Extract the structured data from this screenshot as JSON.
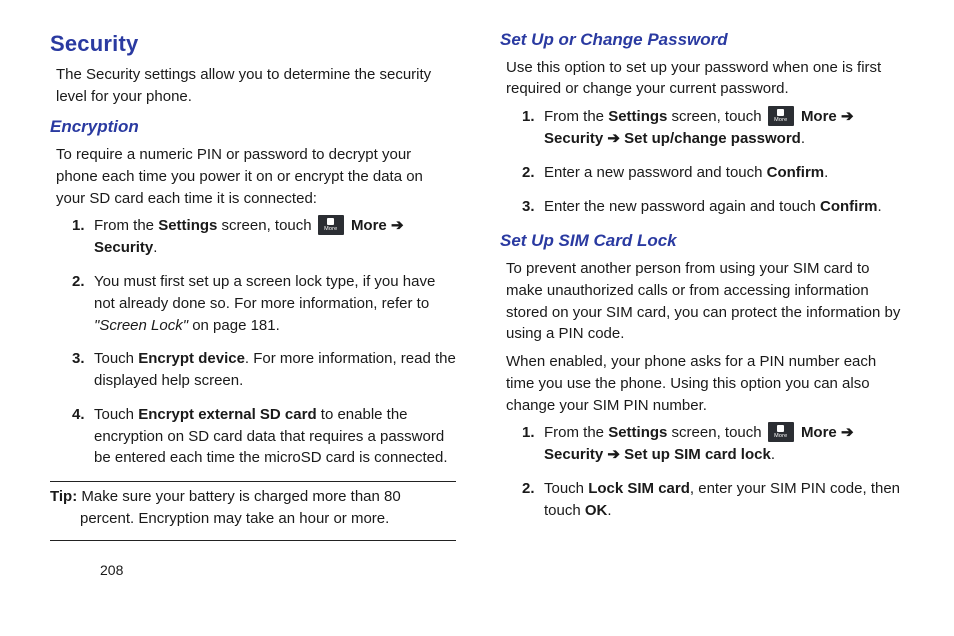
{
  "pageNumber": "208",
  "moreLabel": "More",
  "left": {
    "h1": "Security",
    "intro": "The Security settings allow you to determine the security level for your phone.",
    "enc": {
      "title": "Encryption",
      "intro": "To require a numeric PIN or password to decrypt your phone each time you power it on or encrypt the data on your SD card each time it is connected:",
      "s1a": "From the ",
      "s1b": "Settings",
      "s1c": " screen, touch ",
      "s1d": "More",
      "s1e": " ➔ ",
      "s1f": "Security",
      "s1g": ".",
      "s2a": "You must first set up a screen lock type, if you have not already done so. For more information, refer to ",
      "s2b": "\"Screen Lock\"",
      "s2c": " on page 181.",
      "s3a": "Touch ",
      "s3b": "Encrypt device",
      "s3c": ". For more information, read the displayed help screen.",
      "s4a": "Touch ",
      "s4b": "Encrypt external SD card",
      "s4c": " to enable the encryption on SD card data that requires a password be entered each time the microSD card is connected."
    },
    "tipLabel": "Tip:",
    "tipBody": " Make sure your battery is charged more than 80 percent. Encryption may take an hour or more."
  },
  "right": {
    "pw": {
      "title": "Set Up or Change Password",
      "intro": "Use this option to set up your password when one is first required or change your current password.",
      "s1a": "From the ",
      "s1b": "Settings",
      "s1c": " screen, touch ",
      "s1d": "More",
      "s1e": " ➔ ",
      "s1f": "Security",
      "s1g": " ➔ ",
      "s1h": "Set up/change password",
      "s1i": ".",
      "s2a": "Enter a new password and touch ",
      "s2b": "Confirm",
      "s2c": ".",
      "s3a": "Enter the new password again and touch ",
      "s3b": "Confirm",
      "s3c": "."
    },
    "sim": {
      "title": "Set Up SIM Card Lock",
      "intro1": "To prevent another person from using your SIM card to make unauthorized calls or from accessing information stored on your SIM card, you can protect the information by using a PIN code.",
      "intro2": "When enabled, your phone asks for a PIN number each time you use the phone. Using this option you can also change your SIM PIN number.",
      "s1a": "From the ",
      "s1b": "Settings",
      "s1c": " screen, touch ",
      "s1d": "More",
      "s1e": " ➔ ",
      "s1f": "Security",
      "s1g": " ➔ ",
      "s1h": "Set up SIM card lock",
      "s1i": ".",
      "s2a": "Touch ",
      "s2b": "Lock SIM card",
      "s2c": ", enter your SIM PIN code, then touch ",
      "s2d": "OK",
      "s2e": "."
    }
  }
}
